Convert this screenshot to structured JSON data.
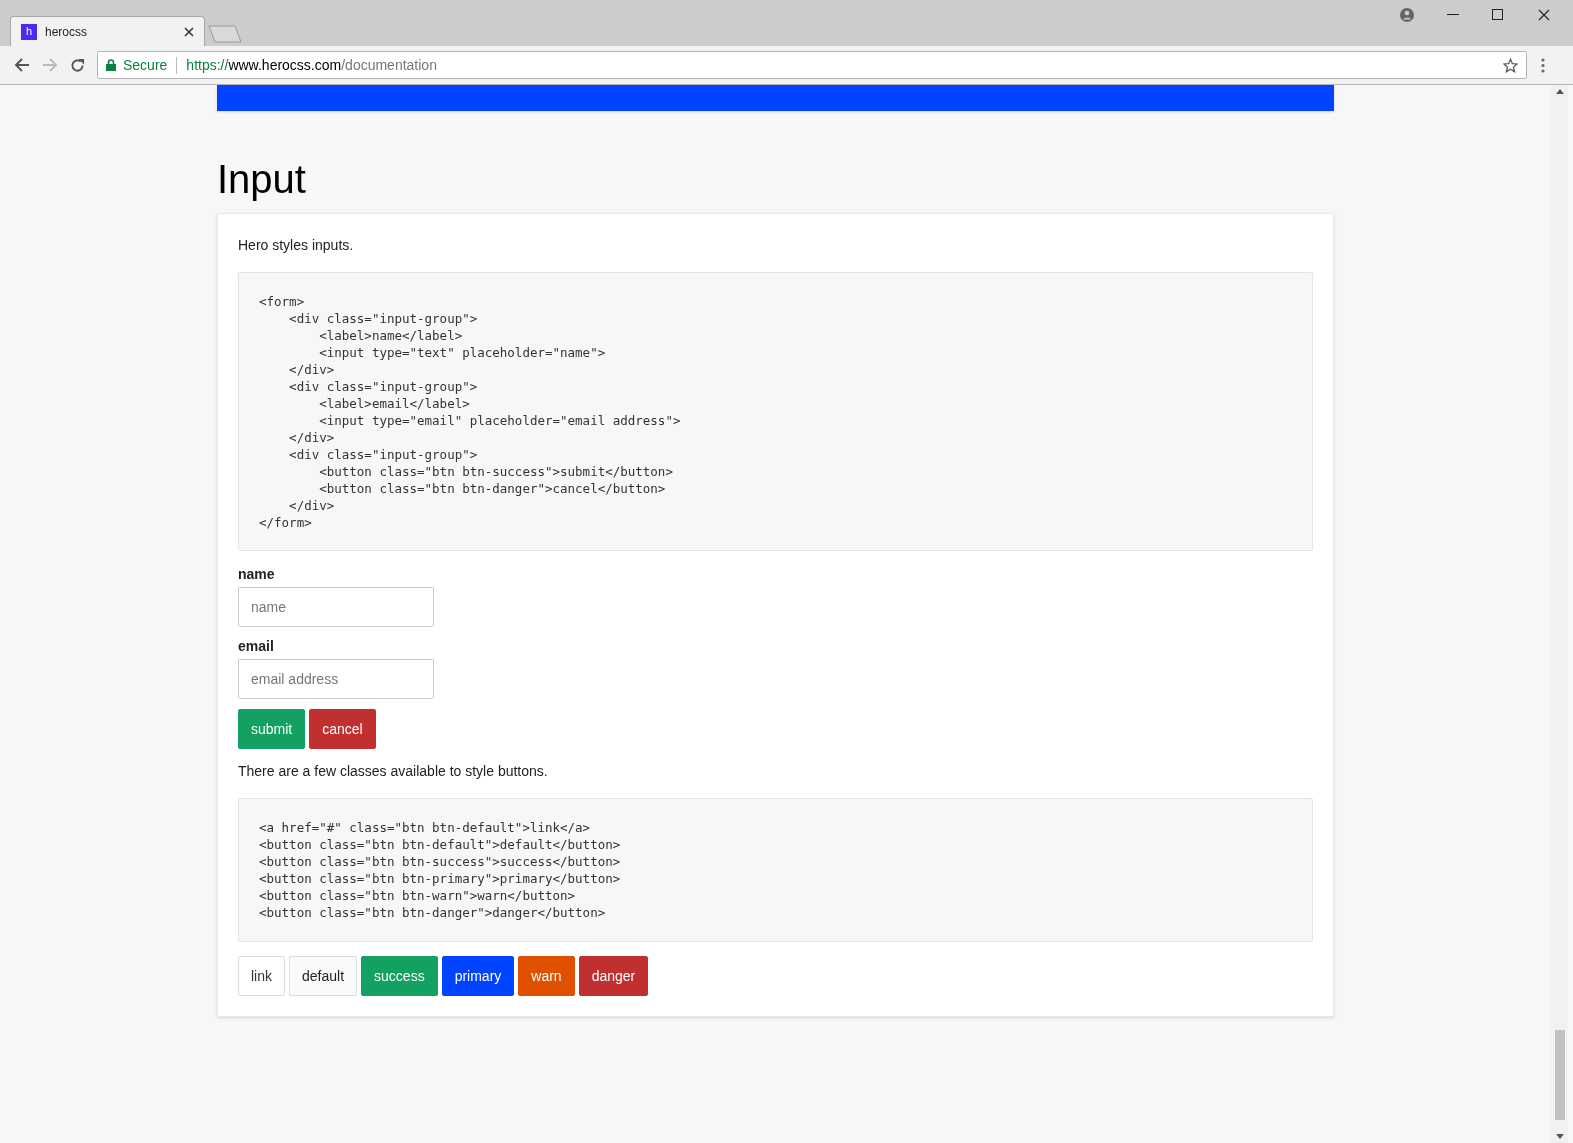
{
  "browser": {
    "tab_title": "herocss",
    "favicon": "h",
    "secure_label": "Secure",
    "url_scheme": "https://",
    "url_host": "www.herocss.com",
    "url_path": "/documentation"
  },
  "section": {
    "title": "Input",
    "intro": "Hero styles inputs.",
    "code_1": [
      "<form>",
      "    <div class=\"input-group\">",
      "        <label>name</label>",
      "        <input type=\"text\" placeholder=\"name\">",
      "    </div>",
      "    <div class=\"input-group\">",
      "        <label>email</label>",
      "        <input type=\"email\" placeholder=\"email address\">",
      "    </div>",
      "    <div class=\"input-group\">",
      "        <button class=\"btn btn-success\">submit</button>",
      "        <button class=\"btn btn-danger\">cancel</button>",
      "    </div>",
      "</form>"
    ],
    "fields": [
      {
        "label": "name",
        "placeholder": "name"
      },
      {
        "label": "email",
        "placeholder": "email address"
      }
    ],
    "form_buttons": [
      {
        "label": "submit",
        "kind": "success"
      },
      {
        "label": "cancel",
        "kind": "danger"
      }
    ],
    "buttons_intro": "There are a few classes available to style buttons.",
    "code_2": [
      "<a href=\"#\" class=\"btn btn-default\">link</a>",
      "<button class=\"btn btn-default\">default</button>",
      "<button class=\"btn btn-success\">success</button>",
      "<button class=\"btn btn-primary\">primary</button>",
      "<button class=\"btn btn-warn\">warn</button>",
      "<button class=\"btn btn-danger\">danger</button>"
    ],
    "demo_buttons": [
      {
        "label": "link",
        "kind": "link"
      },
      {
        "label": "default",
        "kind": "default"
      },
      {
        "label": "success",
        "kind": "success"
      },
      {
        "label": "primary",
        "kind": "primary"
      },
      {
        "label": "warn",
        "kind": "warn"
      },
      {
        "label": "danger",
        "kind": "danger"
      }
    ]
  }
}
